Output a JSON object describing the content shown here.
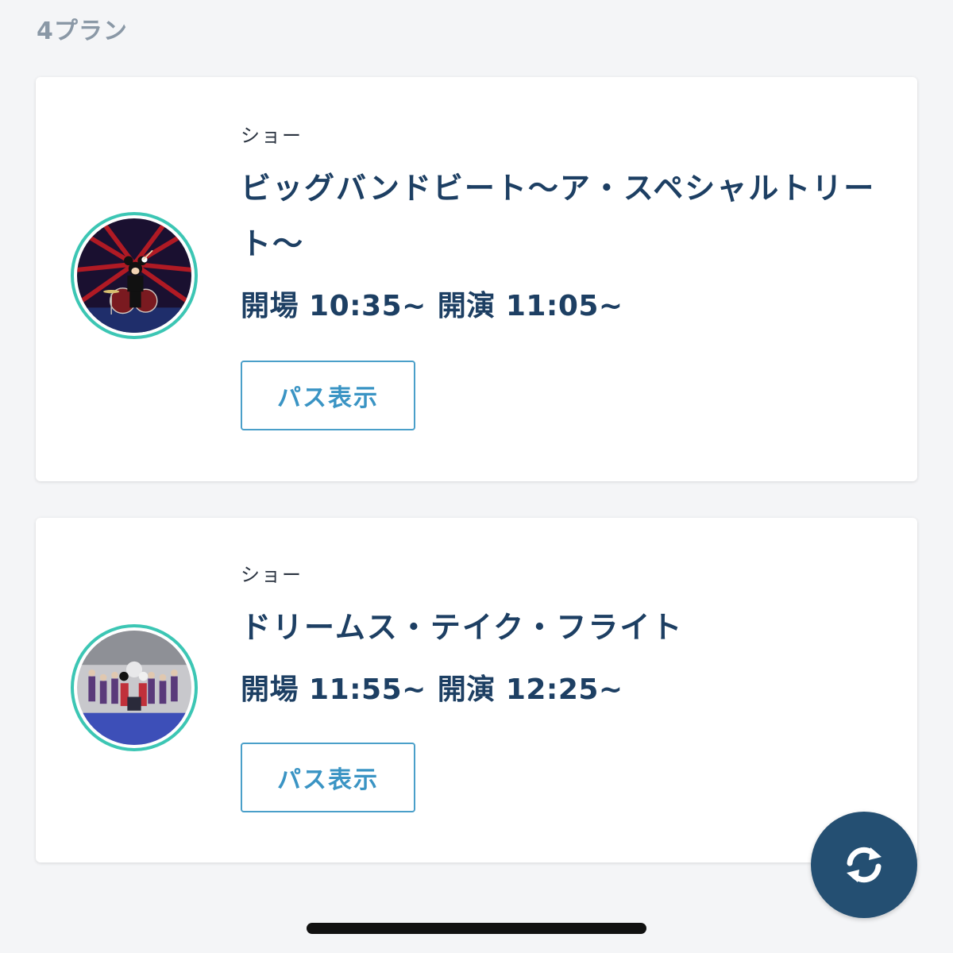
{
  "header": {
    "plan_count_label": "4プラン"
  },
  "plans": [
    {
      "category": "ショー",
      "title": "ビッグバンドビート〜ア・スペシャルトリート〜",
      "open_label": "開場 10:35~",
      "show_label": "開演 11:05~",
      "button_label": "パス表示",
      "thumbnail_icon": "mickey-drummer-image"
    },
    {
      "category": "ショー",
      "title": "ドリームス・テイク・フライト",
      "open_label": "開場 11:55~",
      "show_label": "開演 12:25~",
      "button_label": "パス表示",
      "thumbnail_icon": "stage-performers-image"
    }
  ],
  "fab": {
    "icon": "refresh-icon"
  },
  "colors": {
    "accent_teal": "#3cc6b4",
    "title_navy": "#1d3f63",
    "button_blue": "#3a94c4",
    "fab_navy": "#244f72"
  }
}
